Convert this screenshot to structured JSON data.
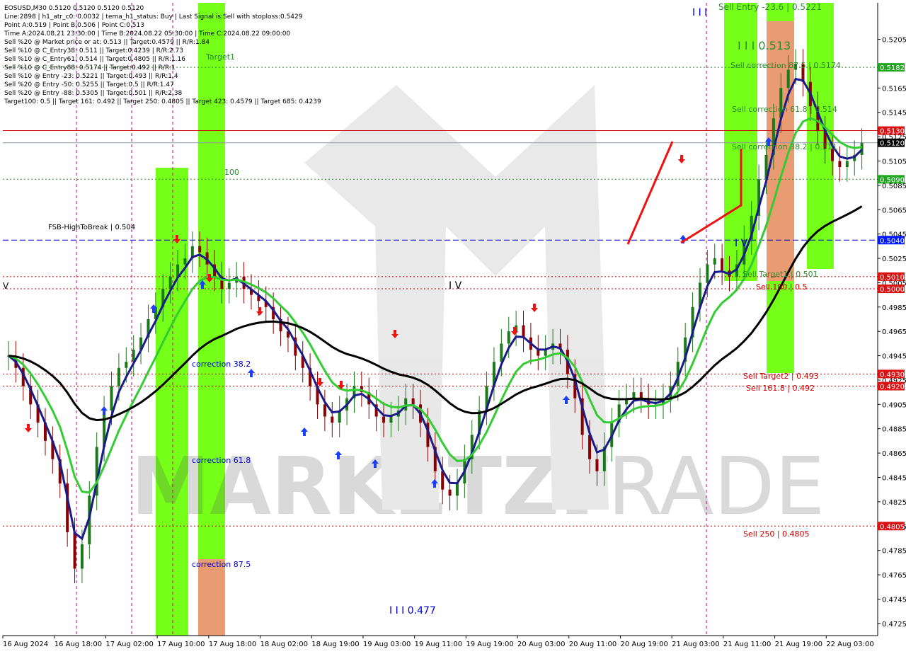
{
  "header": {
    "lines": [
      "EOSUSD,M30  0.5120 0.5120 0.5120 0.5120",
      "Line:2898 | h1_atr_c0: 0.0032 | tema_h1_status: Buy | Last Signal is:Sell with stoploss:0.5429",
      "Point A:0.519 | Point B:0.506 | Point C:0.513",
      "Time A:2024.08.21 23:30:00 | Time B:2024.08.22 05:30:00 | Time C:2024.08.22 09:00:00",
      "Sell %20 @ Market price or at: 0.513 || Target:0.4579 || R/R:1.84",
      "Sell %10 @ C_Entry38: 0.511 || Target:0.4239 | R/R:2.73",
      "Sell %10 @ C_Entry61: 0.514 || Target:0.4805 || R/R:1.16",
      "Sell %10 @ C_Entry88: 0.5174 || Target:0.492 || R/R:1",
      "Sell %10 @ Entry -23: 0.5221 || Target:0.493 || R/R:1.4",
      "Sell %20 @ Entry -50: 0.5255 || Target:0.5 || R/R:1.47",
      "Sell %20 @ Entry -88: 0.5305 || Target:0.501 || R/R:2.38",
      "Target100: 0.5 || Target 161: 0.492 || Target 250: 0.4805 || Target 423: 0.4579 || Target 685: 0.4239"
    ]
  },
  "watermark": {
    "left": "MARKETZI",
    "right": "TRADE"
  },
  "colors": {
    "bull": "#1a7a1a",
    "bear": "#8b0000",
    "green_zone": "#66ff00",
    "orange_zone": "#e8976a",
    "ema_dark": "#1a1a8a",
    "ema_green": "#33cc33",
    "ema_black": "#000000",
    "red_level": "#cc0000",
    "blue_level": "#0000cc",
    "magenta": "#cc0077",
    "price_tag": "#000000"
  },
  "chart_data": {
    "type": "candlestick",
    "symbol": "EOSUSD",
    "timeframe": "M30",
    "ylim": [
      0.4715,
      0.5235
    ],
    "y_ticks": [
      "0.5205",
      "0.5165",
      "0.5145",
      "0.5125",
      "0.5105",
      "0.5085",
      "0.5065",
      "0.5045",
      "0.5025",
      "0.5005",
      "0.4985",
      "0.4965",
      "0.4945",
      "0.4925",
      "0.4905",
      "0.4885",
      "0.4865",
      "0.4845",
      "0.4825",
      "0.4805",
      "0.4785",
      "0.4765",
      "0.4745",
      "0.4725"
    ],
    "x_labels": [
      "16 Aug 2024",
      "16 Aug 18:00",
      "17 Aug 02:00",
      "17 Aug 10:00",
      "17 Aug 18:00",
      "18 Aug 02:00",
      "18 Aug 19:00",
      "19 Aug 03:00",
      "19 Aug 11:00",
      "19 Aug 19:00",
      "20 Aug 03:00",
      "20 Aug 11:00",
      "20 Aug 19:00",
      "21 Aug 03:00",
      "21 Aug 11:00",
      "21 Aug 19:00",
      "22 Aug 03:00"
    ],
    "price_tags": [
      {
        "value": 0.5182,
        "label": "0.5182",
        "kind": "green"
      },
      {
        "value": 0.513,
        "label": "0.5130",
        "kind": "red"
      },
      {
        "value": 0.512,
        "label": "0.5120",
        "kind": "black"
      },
      {
        "value": 0.509,
        "label": "0.5090",
        "kind": "green"
      },
      {
        "value": 0.504,
        "label": "0.5040",
        "kind": "blue"
      },
      {
        "value": 0.501,
        "label": "0.5010",
        "kind": "red"
      },
      {
        "value": 0.5,
        "label": "0.5000",
        "kind": "red"
      },
      {
        "value": 0.493,
        "label": "0.4930",
        "kind": "red"
      },
      {
        "value": 0.492,
        "label": "0.4920",
        "kind": "red"
      },
      {
        "value": 0.4805,
        "label": "0.4805",
        "kind": "red"
      }
    ],
    "levels": [
      {
        "value": 0.5182,
        "style": "dot",
        "kind": "green"
      },
      {
        "value": 0.513,
        "style": "solid",
        "kind": "red"
      },
      {
        "value": 0.512,
        "style": "solid",
        "kind": "gray"
      },
      {
        "value": 0.509,
        "style": "dot",
        "kind": "green"
      },
      {
        "value": 0.504,
        "style": "dash",
        "kind": "blue"
      },
      {
        "value": 0.501,
        "style": "dot",
        "kind": "red"
      },
      {
        "value": 0.5,
        "style": "dot",
        "kind": "red"
      },
      {
        "value": 0.493,
        "style": "dot",
        "kind": "red"
      },
      {
        "value": 0.492,
        "style": "dot",
        "kind": "red"
      },
      {
        "value": 0.4805,
        "style": "dot",
        "kind": "red"
      }
    ],
    "annotations": [
      {
        "text": "Sell Entry -23.6 | 0.5221",
        "kind": "green"
      },
      {
        "text": "I I I 0.513",
        "kind": "green"
      },
      {
        "text": "Sell correction 87.5 | 0.5174",
        "kind": "green"
      },
      {
        "text": "Sell correction 61.8 | 0.514",
        "kind": "green"
      },
      {
        "text": "Sell correction 38.2 | 0.511",
        "kind": "green"
      },
      {
        "text": "Sell Target1 | 0.501",
        "kind": "green"
      },
      {
        "text": "Sell 100 | 0.5",
        "kind": "red"
      },
      {
        "text": "Sell Target2 | 0.493",
        "kind": "red"
      },
      {
        "text": "Sell 161.8 | 0.492",
        "kind": "red"
      },
      {
        "text": "Sell  250 | 0.4805",
        "kind": "red"
      },
      {
        "text": "FSB-HighToBreak  |  0.504",
        "kind": "black"
      },
      {
        "text": "Target1",
        "kind": "green"
      },
      {
        "text": "100",
        "kind": "green"
      },
      {
        "text": "correction 38.2",
        "kind": "blue"
      },
      {
        "text": "correction 61.8",
        "kind": "blue"
      },
      {
        "text": "correction 87.5",
        "kind": "blue"
      },
      {
        "text": "I I I 0.477",
        "kind": "blue"
      },
      {
        "text": "I V",
        "kind": "black"
      },
      {
        "text": "I V",
        "kind": "blue"
      },
      {
        "text": "V",
        "kind": "black"
      },
      {
        "text": "I I I",
        "kind": "blue"
      }
    ],
    "close_series": [
      0.4945,
      0.4935,
      0.492,
      0.4905,
      0.489,
      0.4875,
      0.486,
      0.484,
      0.48,
      0.477,
      0.479,
      0.483,
      0.487,
      0.49,
      0.492,
      0.4935,
      0.494,
      0.495,
      0.496,
      0.4975,
      0.4985,
      0.5,
      0.501,
      0.502,
      0.5025,
      0.5035,
      0.503,
      0.502,
      0.501,
      0.5,
      0.5005,
      0.501,
      0.5,
      0.4995,
      0.499,
      0.4985,
      0.4975,
      0.4965,
      0.496,
      0.4945,
      0.4935,
      0.492,
      0.4905,
      0.4895,
      0.489,
      0.49,
      0.491,
      0.492,
      0.4915,
      0.4905,
      0.4895,
      0.489,
      0.4895,
      0.49,
      0.491,
      0.4905,
      0.489,
      0.487,
      0.485,
      0.4835,
      0.483,
      0.484,
      0.486,
      0.488,
      0.49,
      0.492,
      0.494,
      0.4955,
      0.4965,
      0.497,
      0.496,
      0.495,
      0.4945,
      0.495,
      0.4955,
      0.495,
      0.493,
      0.491,
      0.488,
      0.486,
      0.485,
      0.487,
      0.489,
      0.4905,
      0.491,
      0.4915,
      0.491,
      0.4905,
      0.4905,
      0.491,
      0.492,
      0.494,
      0.496,
      0.4985,
      0.5005,
      0.502,
      0.5025,
      0.5015,
      0.501,
      0.502,
      0.504,
      0.506,
      0.509,
      0.511,
      0.514,
      0.5165,
      0.518,
      0.5185,
      0.517,
      0.515,
      0.513,
      0.5115,
      0.5105,
      0.51,
      0.5105,
      0.511,
      0.512
    ]
  }
}
